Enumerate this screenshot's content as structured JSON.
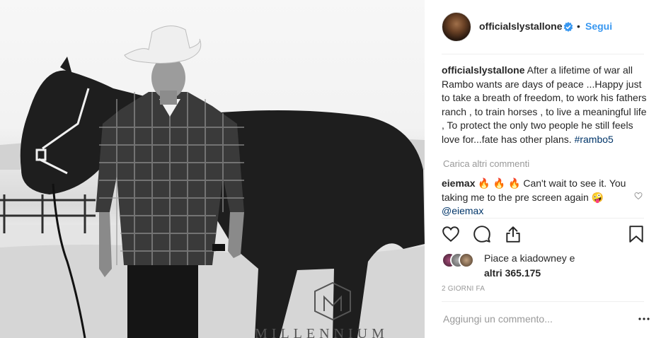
{
  "post": {
    "username": "officialslystallone",
    "follow_label": "Segui",
    "separator": "•",
    "caption_text": "After a lifetime of war all Rambo wants are days of peace ...Happy just to take a breath of freedom, to work his fathers ranch , to train horses , to live a meaningful life , To protect the only two people he still feels love for...fate has other plans.",
    "hashtag": "#rambo5",
    "photo_watermark": "MILLENNIUM"
  },
  "comments": {
    "load_more_label": "Carica altri commenti",
    "items": [
      {
        "username": "eiemax",
        "emojis": "🔥 🔥 🔥",
        "text_before": "Can't wait to see it. You taking me to the pre screen again",
        "emoji_after": "🤪",
        "mention": "@eiemax"
      }
    ]
  },
  "likes": {
    "line1": "Piace a kiadowney e",
    "line2": "altri 365.175"
  },
  "timestamp": "2 GIORNI FA",
  "add_comment_placeholder": "Aggiungi un commento...",
  "icons": {
    "verified": "verified-badge-icon",
    "like": "heart-icon",
    "comment": "comment-bubble-icon",
    "share": "share-icon",
    "save": "bookmark-icon",
    "more": "more-options-icon"
  },
  "colors": {
    "link_blue": "#3897f0",
    "hashtag": "#003569",
    "muted": "#999999",
    "text": "#262626"
  }
}
